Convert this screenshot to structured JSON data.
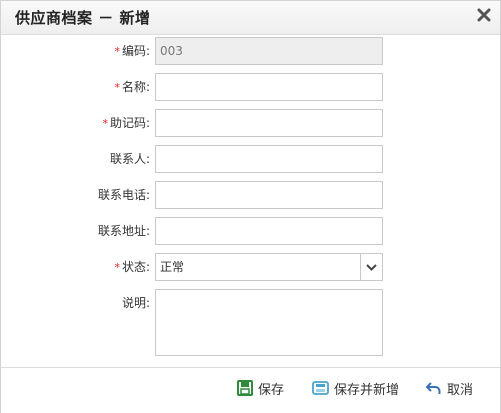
{
  "dialog": {
    "title": "供应商档案 － 新增"
  },
  "form": {
    "fields": [
      {
        "label": "编码:",
        "required": true,
        "value": "003"
      },
      {
        "label": "名称:",
        "required": true,
        "value": ""
      },
      {
        "label": "助记码:",
        "required": true,
        "value": ""
      },
      {
        "label": "联系人:",
        "required": false,
        "value": ""
      },
      {
        "label": "联系电话:",
        "required": false,
        "value": ""
      },
      {
        "label": "联系地址:",
        "required": false,
        "value": ""
      },
      {
        "label": "状态:",
        "required": true,
        "value": "正常"
      },
      {
        "label": "说明:",
        "required": false,
        "value": ""
      }
    ],
    "required_mark": "*"
  },
  "footer": {
    "save_label": "保存",
    "save_new_label": "保存并新增",
    "cancel_label": "取消"
  },
  "colors": {
    "required": "#e02020",
    "save_icon": "#2e8b3a",
    "save_new_icon": "#4aa3c9",
    "cancel_icon": "#3b6fb6"
  },
  "icons": {
    "close": "close-icon",
    "select_arrow": "chevron-down-icon",
    "save": "save-icon",
    "save_new": "save-new-icon",
    "cancel": "undo-icon"
  }
}
